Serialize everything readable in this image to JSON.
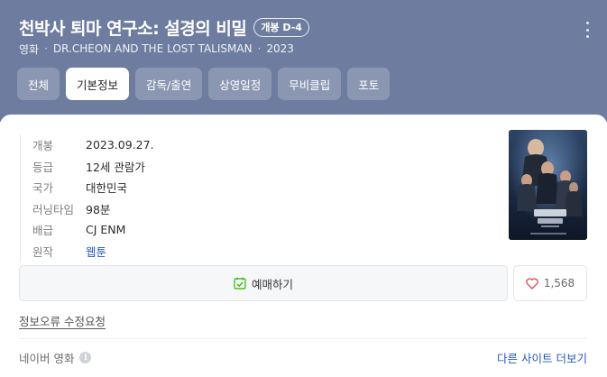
{
  "header": {
    "title": "천박사 퇴마 연구소: 설경의 비밀",
    "badge": "개봉 D-4",
    "category": "영화",
    "english_title": "DR.CHEON AND THE LOST TALISMAN",
    "separator": "·",
    "year": "2023",
    "more_icon": "more-vertical-icon"
  },
  "tabs": [
    {
      "label": "전체",
      "active": false
    },
    {
      "label": "기본정보",
      "active": true
    },
    {
      "label": "감독/출연",
      "active": false
    },
    {
      "label": "상영일정",
      "active": false
    },
    {
      "label": "무비클립",
      "active": false
    },
    {
      "label": "포토",
      "active": false
    }
  ],
  "info": [
    {
      "label": "개봉",
      "value": "2023.09.27."
    },
    {
      "label": "등급",
      "value": "12세 관람가"
    },
    {
      "label": "국가",
      "value": "대한민국"
    },
    {
      "label": "러닝타임",
      "value": "98분"
    },
    {
      "label": "배급",
      "value": "CJ ENM"
    },
    {
      "label": "원작",
      "value": "웹툰"
    }
  ],
  "actions": {
    "reserve_label": "예매하기",
    "reserve_icon": "calendar-check-icon",
    "like_count": "1,568",
    "like_icon": "heart-icon"
  },
  "report_link": "정보오류 수정요청",
  "footer": {
    "source": "네이버 영화",
    "info_icon_glyph": "i",
    "more_sites": "다른 사이트 더보기"
  },
  "colors": {
    "header_bg": "#6e7d9f",
    "link": "#2457c2",
    "reserve_icon": "#2db400",
    "heart": "#e2474b"
  }
}
